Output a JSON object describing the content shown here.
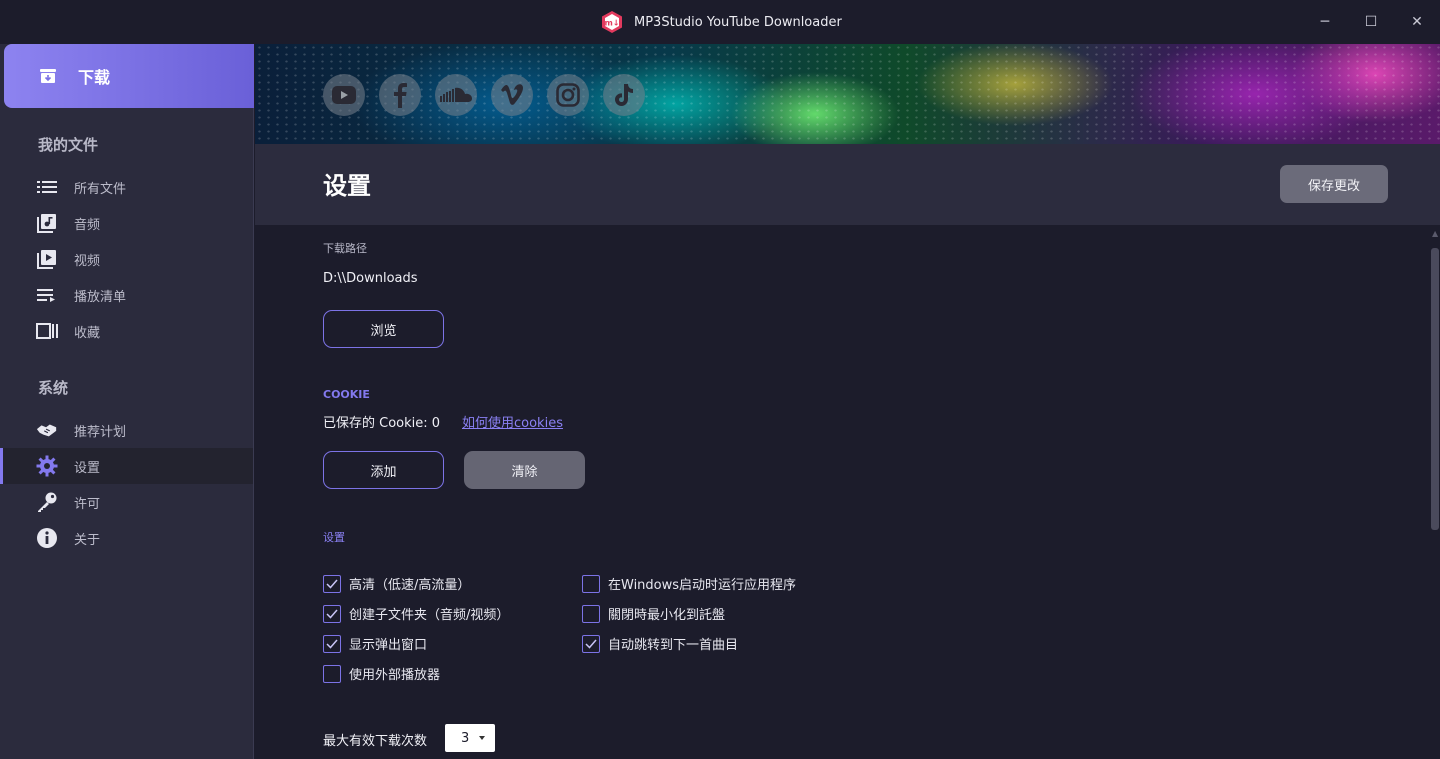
{
  "window": {
    "title": "MP3Studio YouTube Downloader",
    "logo_text": "m↓",
    "minimize": "─",
    "maximize": "☐",
    "close": "✕"
  },
  "sidebar": {
    "download_label": "下载",
    "my_files_heading": "我的文件",
    "file_items": [
      {
        "label": "所有文件",
        "icon": "list-icon"
      },
      {
        "label": "音频",
        "icon": "music-note-icon"
      },
      {
        "label": "视频",
        "icon": "video-play-icon"
      },
      {
        "label": "播放清单",
        "icon": "playlist-icon"
      },
      {
        "label": "收藏",
        "icon": "collection-icon"
      }
    ],
    "system_heading": "系统",
    "system_items": [
      {
        "label": "推荐计划",
        "icon": "handshake-icon"
      },
      {
        "label": "设置",
        "icon": "gear-icon",
        "active": true
      },
      {
        "label": "许可",
        "icon": "key-icon"
      },
      {
        "label": "关于",
        "icon": "info-icon"
      }
    ]
  },
  "banner": {
    "socials": [
      "youtube-icon",
      "facebook-icon",
      "soundcloud-icon",
      "vimeo-icon",
      "instagram-icon",
      "tiktok-icon"
    ]
  },
  "settings": {
    "title": "设置",
    "save_label": "保存更改",
    "download_path_label": "下载路径",
    "download_path": "D:\\\\Downloads",
    "browse_label": "浏览",
    "cookie_heading": "COOKIE",
    "cookie_saved": "已保存的 Cookie: 0",
    "cookie_link": "如何使用cookies",
    "add_label": "添加",
    "clear_label": "清除",
    "options_heading": "设置",
    "options_left": [
      {
        "label": "高清（低速/高流量）",
        "checked": true
      },
      {
        "label": "创建子文件夹（音频/视频）",
        "checked": true
      },
      {
        "label": "显示弹出窗口",
        "checked": true
      },
      {
        "label": "使用外部播放器",
        "checked": false
      }
    ],
    "options_right": [
      {
        "label": "在Windows启动时运行应用程序",
        "checked": false
      },
      {
        "label": "關閉時最小化到託盤",
        "checked": false
      },
      {
        "label": "自动跳转到下一首曲目",
        "checked": true
      }
    ],
    "max_downloads_label": "最大有效下载次数",
    "max_downloads_value": "3"
  },
  "colors": {
    "accent": "#8379ee",
    "sidebar_bg": "#2b2b3d",
    "content_bg": "#1c1c2b",
    "logo_red": "#e23a5e"
  }
}
